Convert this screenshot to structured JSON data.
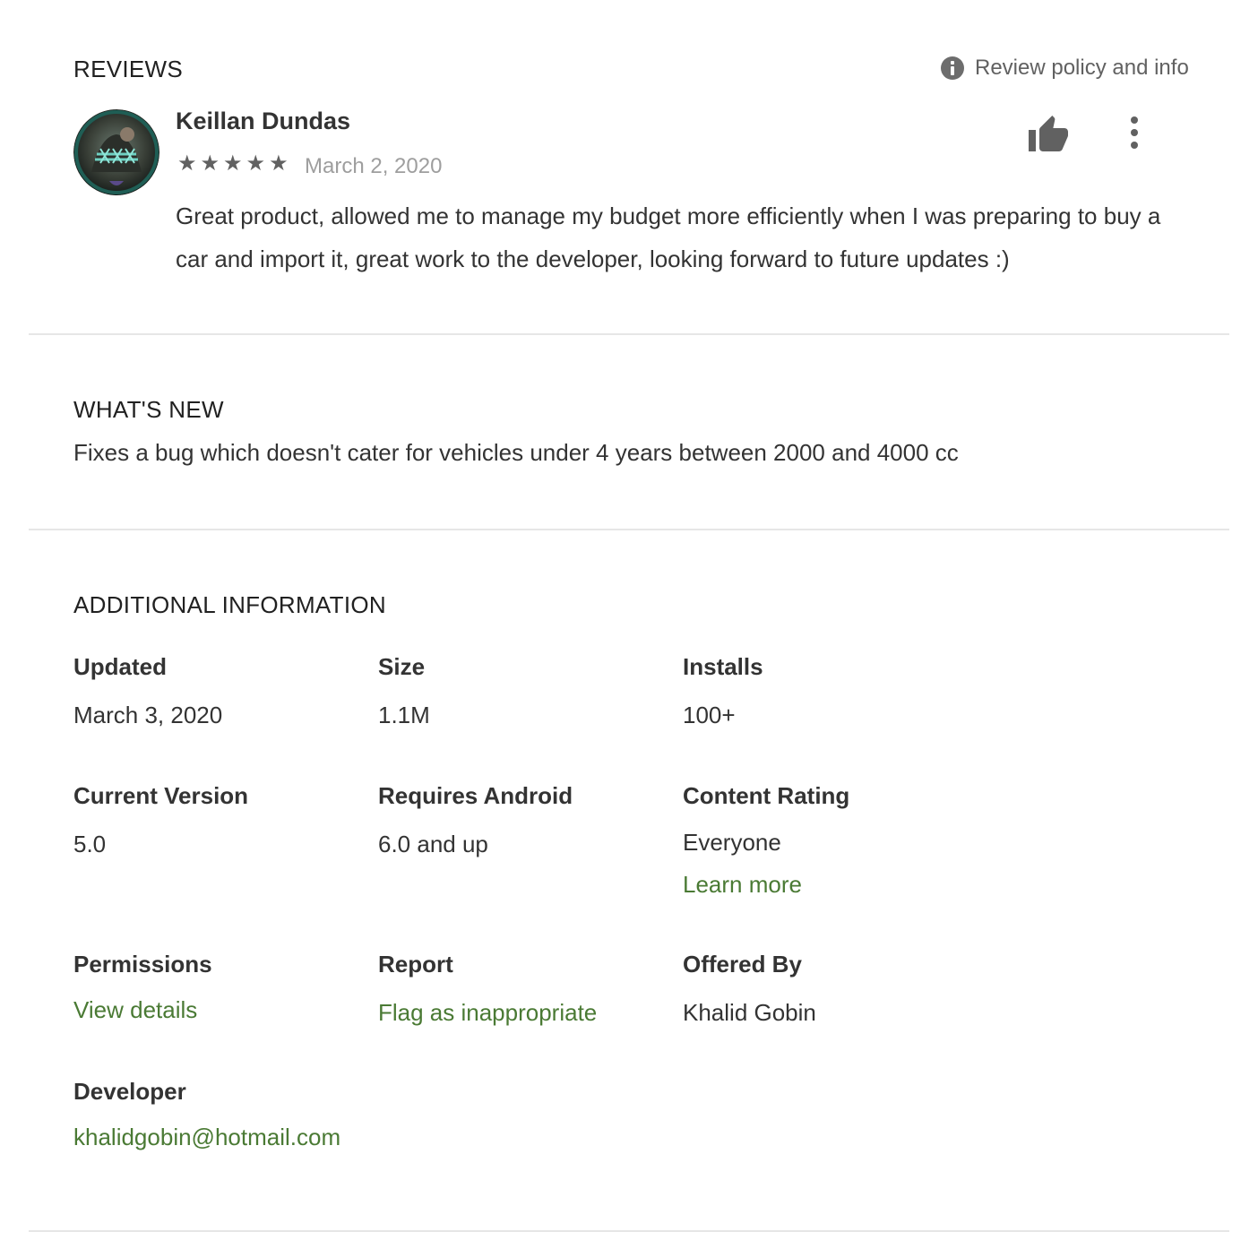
{
  "reviews": {
    "title": "REVIEWS",
    "policy_link": "Review policy and info",
    "review": {
      "author": "Keillan Dundas",
      "rating": 5,
      "date": "March 2, 2020",
      "text": "Great product, allowed me to manage my budget more efficiently when I was preparing to buy a car and import it, great work to the developer, looking forward to future updates :)"
    },
    "icons": {
      "info": "info-icon",
      "thumb": "thumbs-up-icon",
      "more": "more-vert-icon",
      "star": "star-icon"
    }
  },
  "whats_new": {
    "title": "WHAT'S NEW",
    "text": "Fixes a bug which doesn't cater for vehicles under 4 years between 2000 and 4000 cc"
  },
  "additional_info": {
    "title": "ADDITIONAL INFORMATION",
    "updated": {
      "label": "Updated",
      "value": "March 3, 2020"
    },
    "size": {
      "label": "Size",
      "value": "1.1M"
    },
    "installs": {
      "label": "Installs",
      "value": "100+"
    },
    "current_version": {
      "label": "Current Version",
      "value": "5.0"
    },
    "requires_android": {
      "label": "Requires Android",
      "value": "6.0 and up"
    },
    "content_rating": {
      "label": "Content Rating",
      "value": "Everyone",
      "link": "Learn more"
    },
    "permissions": {
      "label": "Permissions",
      "link": "View details"
    },
    "report": {
      "label": "Report",
      "link": "Flag as inappropriate"
    },
    "offered_by": {
      "label": "Offered By",
      "value": "Khalid Gobin"
    },
    "developer": {
      "label": "Developer",
      "link": "khalidgobin@hotmail.com"
    }
  },
  "colors": {
    "link": "#4a7a34",
    "text": "#333333",
    "muted": "#9e9e9e",
    "icon": "#616161",
    "divider": "#e6e6e6"
  }
}
